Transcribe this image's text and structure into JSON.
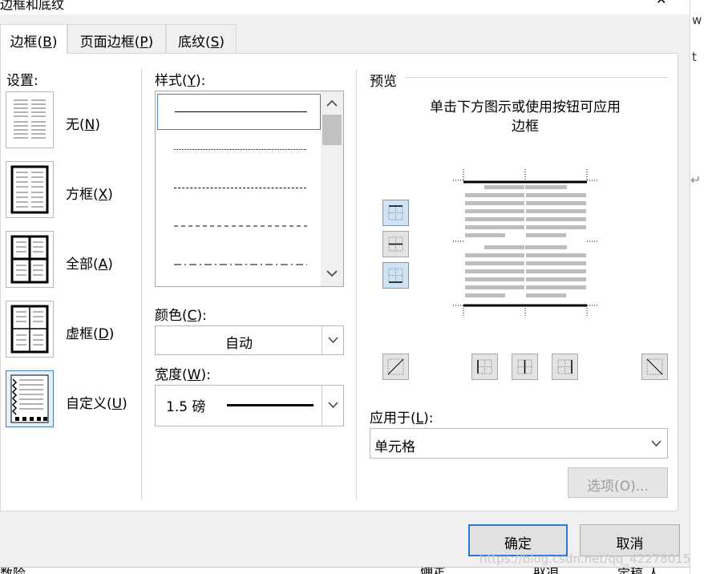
{
  "title": "边框和底纹",
  "tabs": [
    {
      "label": "边框(",
      "key": "B",
      "close": ")"
    },
    {
      "label": "页面边框(",
      "key": "P",
      "close": ")"
    },
    {
      "label": "底纹(",
      "key": "S",
      "close": ")"
    }
  ],
  "setting": {
    "heading": "设置:",
    "items": [
      {
        "label": "无(",
        "key": "N",
        "close": ")"
      },
      {
        "label": "方框(",
        "key": "X",
        "close": ")"
      },
      {
        "label": "全部(",
        "key": "A",
        "close": ")"
      },
      {
        "label": "虚框(",
        "key": "D",
        "close": ")"
      },
      {
        "label": "自定义(",
        "key": "U",
        "close": ")"
      }
    ]
  },
  "style": {
    "heading": "样式(",
    "key": "Y",
    "close": "):"
  },
  "color": {
    "heading": "颜色(",
    "key": "C",
    "close": "):",
    "value": "自动"
  },
  "width": {
    "heading": "宽度(",
    "key": "W",
    "close": "):",
    "value": "1.5 磅"
  },
  "preview": {
    "heading": "预览",
    "hint": "单击下方图示或使用按钮可应用\n边框"
  },
  "apply": {
    "heading": "应用于(",
    "key": "L",
    "close": "):",
    "value": "单元格"
  },
  "options_button": "选项(O)...",
  "ok_button": "确定",
  "cancel_button": "取消",
  "background_fragments": {
    "behind_bottom_left": "数险",
    "behind_ok": "确定",
    "behind_cancel": "取消",
    "behind_right": "定稿 人"
  },
  "right_strip": {
    "char1": "w",
    "char2": "t"
  },
  "watermark": "https://blog.csdn.net/qq_42278015"
}
